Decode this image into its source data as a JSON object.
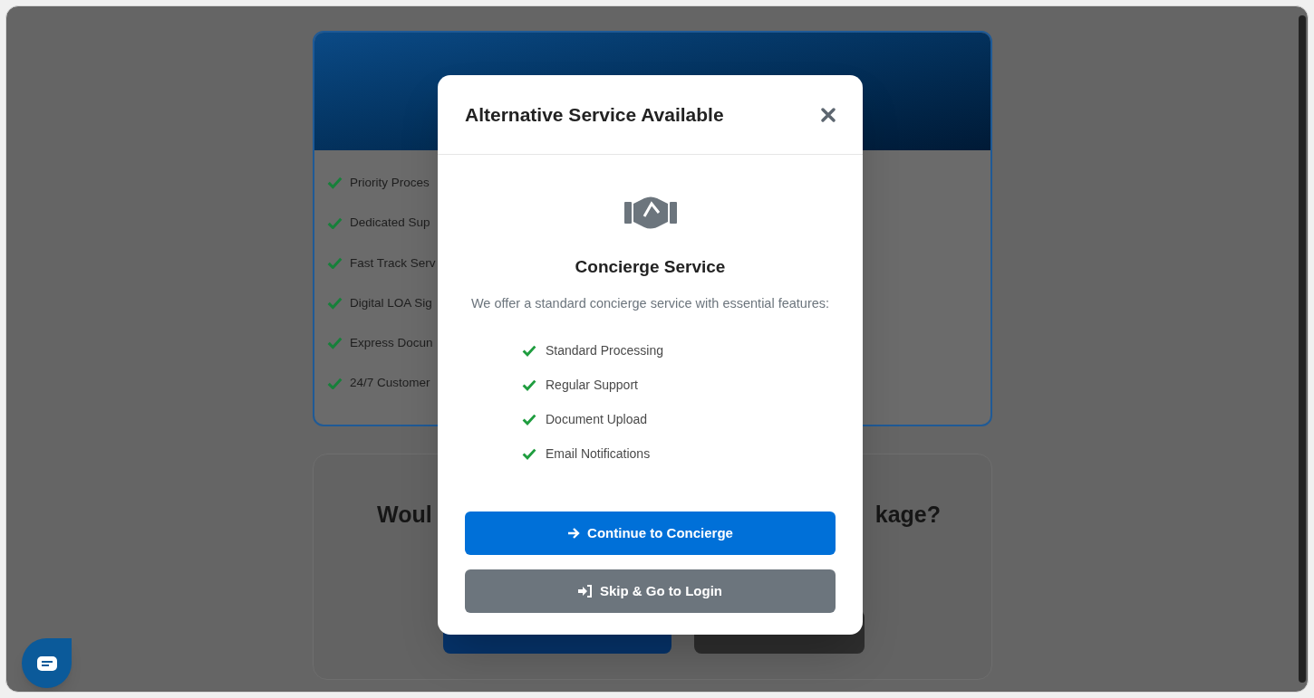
{
  "vip_card": {
    "features": [
      "Priority Proces",
      "Dedicated Sup",
      "Fast Track Serv",
      "Digital LOA Sig",
      "Express Docun",
      "24/7 Customer"
    ]
  },
  "upgrade_card": {
    "heading_left": "Woul",
    "heading_right": "kage?",
    "buttons": [
      {
        "kind": "primary"
      },
      {
        "kind": "secondary"
      }
    ]
  },
  "modal": {
    "title": "Alternative Service Available",
    "service_title": "Concierge Service",
    "description": "We offer a standard concierge service with essential features:",
    "features": [
      "Standard Processing",
      "Regular Support",
      "Document Upload",
      "Email Notifications"
    ],
    "buttons": [
      {
        "kind": "primary",
        "label": "Continue to Concierge"
      },
      {
        "kind": "secondary",
        "label": "Skip & Go to Login"
      }
    ]
  }
}
